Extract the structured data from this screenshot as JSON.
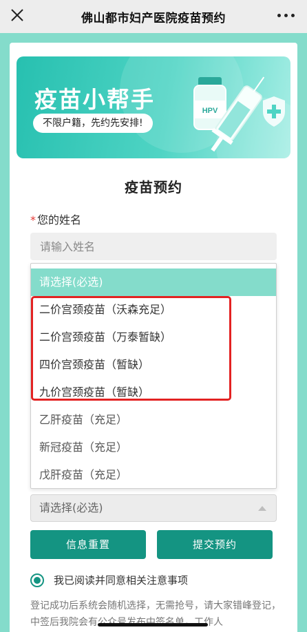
{
  "header": {
    "title": "佛山都市妇产医院疫苗预约",
    "close_icon": "close-icon",
    "more_icon": "more-dots-icon"
  },
  "banner": {
    "headline": "疫苗小帮手",
    "tagline": "不限户籍，先约先安排!",
    "art_label": "HPV"
  },
  "form": {
    "title": "疫苗预约",
    "name_label": "您的姓名",
    "required_mark": "*",
    "name_placeholder": "请输入姓名",
    "vaccine_options": [
      "请选择(必选)",
      "二价宫颈疫苗（沃森充足）",
      "二价宫颈疫苗（万泰暂缺）",
      "四价宫颈疫苗（暂缺）",
      "九价宫颈疫苗（暂缺）",
      "乙肝疫苗（充足）",
      "新冠疫苗（充足）",
      "戊肝疫苗（充足）"
    ],
    "second_select_value": "请选择(必选)",
    "reset_label": "信息重置",
    "submit_label": "提交预约",
    "agree_label": "我已阅读并同意相关注意事项",
    "note_text": "登记成功后系统会随机选择，无需抢号，请大家错峰登记，中签后我院会有公众号发布中签名单，工作人"
  },
  "colors": {
    "accent": "#149482",
    "page_bg": "#84dccb",
    "highlight": "#e32222"
  }
}
